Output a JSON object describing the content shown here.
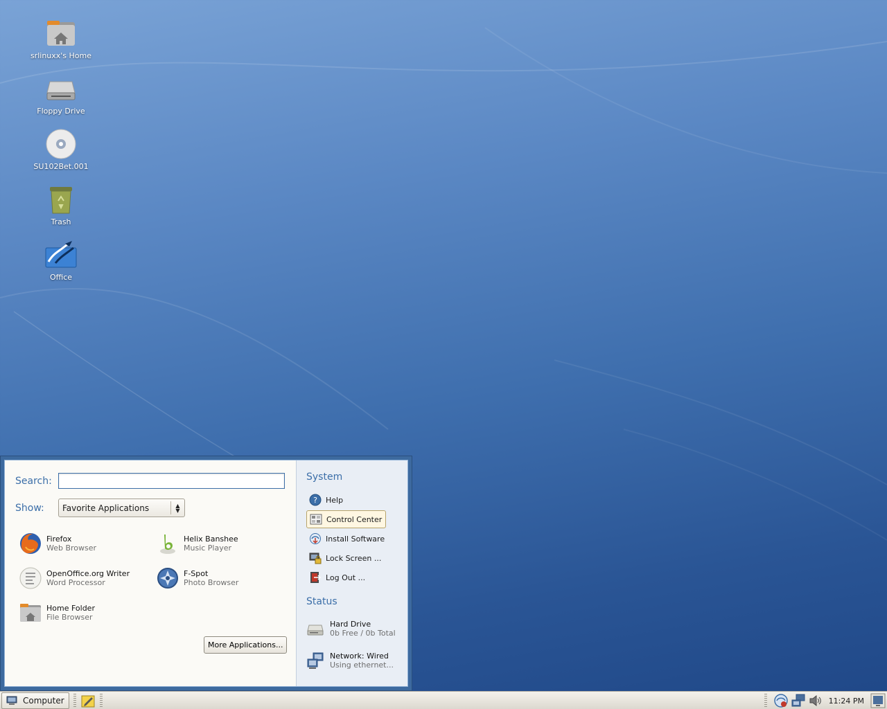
{
  "desktop": {
    "icons": [
      {
        "label": "srlinuxx's Home",
        "icon": "home-folder-icon"
      },
      {
        "label": "Floppy Drive",
        "icon": "floppy-drive-icon"
      },
      {
        "label": "SU102Bet.001",
        "icon": "cd-disc-icon"
      },
      {
        "label": "Trash",
        "icon": "trash-icon"
      },
      {
        "label": "Office",
        "icon": "office-icon"
      }
    ]
  },
  "menu": {
    "search_label": "Search:",
    "search_value": "",
    "show_label": "Show:",
    "show_selected": "Favorite Applications",
    "apps": [
      {
        "name": "Firefox",
        "desc": "Web Browser",
        "icon": "firefox-icon"
      },
      {
        "name": "Helix Banshee",
        "desc": "Music Player",
        "icon": "banshee-icon"
      },
      {
        "name": "OpenOffice.org Writer",
        "desc": "Word Processor",
        "icon": "writer-icon"
      },
      {
        "name": "F-Spot",
        "desc": "Photo Browser",
        "icon": "fspot-icon"
      },
      {
        "name": "Home Folder",
        "desc": "File Browser",
        "icon": "home-folder-icon"
      }
    ],
    "more_button": "More Applications...",
    "system": {
      "title": "System",
      "items": [
        {
          "label": "Help",
          "icon": "help-icon"
        },
        {
          "label": "Control Center",
          "icon": "control-center-icon"
        },
        {
          "label": "Install Software",
          "icon": "install-software-icon"
        },
        {
          "label": "Lock Screen ...",
          "icon": "lock-screen-icon"
        },
        {
          "label": "Log Out ...",
          "icon": "logout-icon"
        }
      ]
    },
    "status": {
      "title": "Status",
      "items": [
        {
          "title": "Hard Drive",
          "detail": "0b Free / 0b Total",
          "icon": "hard-drive-icon"
        },
        {
          "title": "Network: Wired",
          "detail": "Using ethernet...",
          "icon": "network-wired-icon"
        }
      ]
    }
  },
  "taskbar": {
    "computer_label": "Computer",
    "clock": "11:24 PM"
  },
  "colors": {
    "accent": "#3b6ea8",
    "menu_frame": "#3d6a9f",
    "highlight_border": "#b7a36a"
  }
}
